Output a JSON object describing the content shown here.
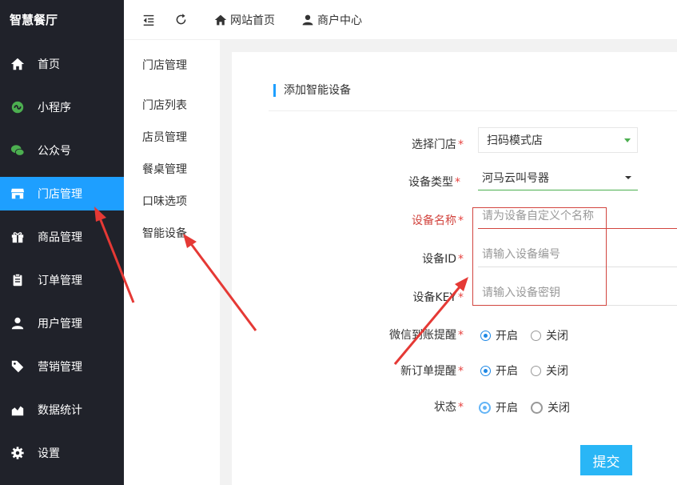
{
  "brand": "智慧餐厅",
  "sidebar": {
    "items": [
      {
        "label": "首页",
        "icon": "home-icon"
      },
      {
        "label": "小程序",
        "icon": "mini-program-icon"
      },
      {
        "label": "公众号",
        "icon": "wechat-icon"
      },
      {
        "label": "门店管理",
        "icon": "store-icon",
        "active": true
      },
      {
        "label": "商品管理",
        "icon": "gift-icon"
      },
      {
        "label": "订单管理",
        "icon": "clipboard-icon"
      },
      {
        "label": "用户管理",
        "icon": "user-icon"
      },
      {
        "label": "营销管理",
        "icon": "tag-icon"
      },
      {
        "label": "数据统计",
        "icon": "chart-icon"
      },
      {
        "label": "设置",
        "icon": "gear-icon"
      }
    ]
  },
  "topbar": {
    "home_link": "网站首页",
    "merchant_link": "商户中心"
  },
  "submenu": {
    "heading": "门店管理",
    "items": [
      "门店列表",
      "店员管理",
      "餐桌管理",
      "口味选项",
      "智能设备"
    ]
  },
  "form": {
    "title": "添加智能设备",
    "store_label": "选择门店",
    "store_value": "扫码模式店",
    "type_label": "设备类型",
    "type_value": "河马云叫号器",
    "name_label": "设备名称",
    "name_placeholder": "请为设备自定义个名称",
    "id_label": "设备ID",
    "id_placeholder": "请输入设备编号",
    "key_label": "设备KEY",
    "key_placeholder": "请输入设备密钥",
    "wx_label": "微信到账提醒",
    "order_label": "新订单提醒",
    "status_label": "状态",
    "on_label": "开启",
    "off_label": "关闭",
    "required_mark": "*",
    "submit_label": "提交"
  },
  "colors": {
    "sidebar_bg": "#20222a",
    "active": "#1e9fff",
    "annotation": "#e53935",
    "submit": "#29b6f6"
  }
}
